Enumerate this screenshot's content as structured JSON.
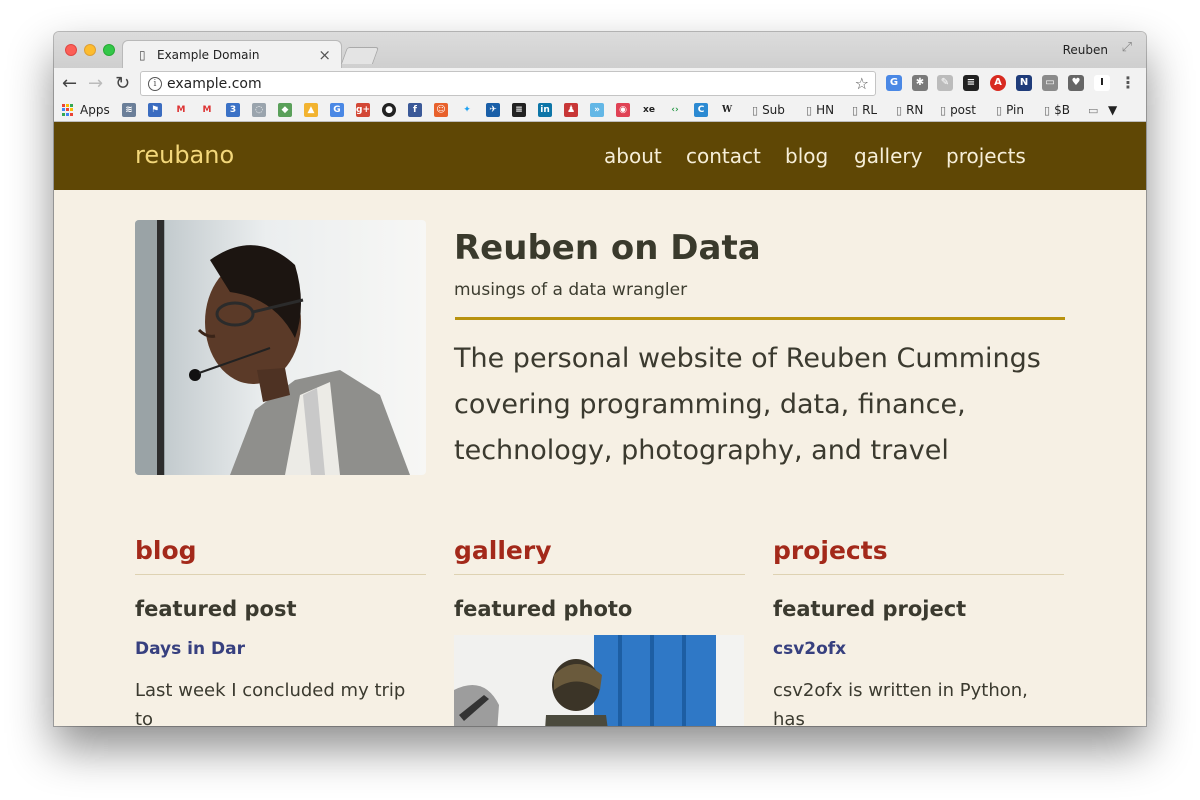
{
  "browser": {
    "tab_title": "Example Domain",
    "tab_close": "×",
    "profile_name": "Reuben",
    "url": "example.com",
    "star_icon": "☆",
    "menu_icon": "⋮",
    "back_icon": "←",
    "forward_icon": "→",
    "reload_icon": "↻",
    "info_icon": "i"
  },
  "bookmarks": {
    "apps": "Apps",
    "sub": "Sub",
    "hn": "HN",
    "rl": "RL",
    "rn": "RN",
    "post": "post",
    "pin": "Pin",
    "sb": "$B",
    "more": "▼"
  },
  "site": {
    "brand": "reubano",
    "nav": {
      "about": "about",
      "contact": "contact",
      "blog": "blog",
      "gallery": "gallery",
      "projects": "projects"
    },
    "hero": {
      "title": "Reuben on Data",
      "subtitle": "musings of a data wrangler",
      "description": "The personal website of Reuben Cummings covering programming, data, finance, technology, photography, and travel"
    },
    "columns": {
      "blog": {
        "heading": "blog",
        "sub": "featured post",
        "link": "Days in Dar",
        "text": "Last week I concluded my trip to"
      },
      "gallery": {
        "heading": "gallery",
        "sub": "featured photo"
      },
      "projects": {
        "heading": "projects",
        "sub": "featured project",
        "link": "csv2ofx",
        "text": "csv2ofx is written in Python, has"
      }
    }
  },
  "colors": {
    "header_bg": "#5f4705",
    "brand": "#f3d77a",
    "accent_rule": "#b8920f",
    "section_heading": "#a3291a",
    "link": "#37407f",
    "page_bg": "#f6f0e4"
  }
}
